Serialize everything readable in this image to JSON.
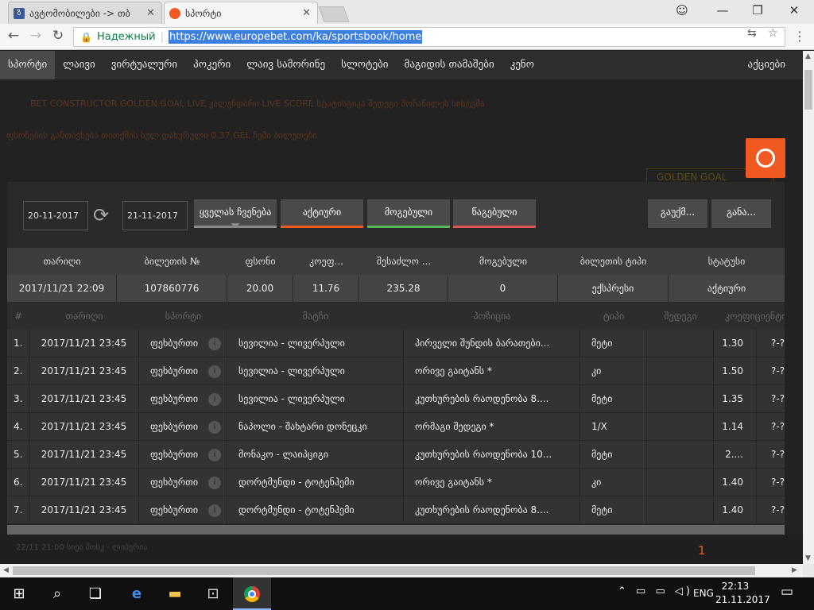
{
  "browser": {
    "tabs": [
      {
        "title": "ავტომობილები -> თბ",
        "favicon_color": "#3b5998"
      },
      {
        "title": "სპორტი",
        "favicon_color": "#f05a22"
      }
    ],
    "url": "https://www.europebet.com/ka/sportsbook/home",
    "secure_label": "Надежный"
  },
  "nav": {
    "items": [
      "სპორტი",
      "ლაივი",
      "ვირტუალური",
      "პოკერი",
      "ლაივ სამორინე",
      "სლოტები",
      "მაგიდის თამაშები",
      "კენო"
    ],
    "right": "აქციები"
  },
  "background": {
    "subnav": "BET CONSTRUCTOR   GOLDEN GOAL   LIVE კალენდარი   LIVE SCORE   სტატისტიკა   შედეგი   მონაწილეს სისტემა",
    "subnav2": "ფსონების განთავსება   თითქმის   სულ დახურული 0.37 GEL   ჩემი ბილეთები",
    "golden_goal": "GOLDEN GOAL",
    "bottom_left": "22/11 21:00         სიეა შოსკ - ლიბერია",
    "page_num": "1"
  },
  "filters": {
    "date_from": "20-11-2017",
    "date_to": "21-11-2017",
    "all": "ყველას ჩვენება",
    "active": "აქტიური",
    "won": "მოგებული",
    "lost": "წაგებული",
    "btn_a": "გაუქმ...",
    "btn_b": "განა..."
  },
  "ticket": {
    "headers": [
      "თარიღი",
      "ბილეთის №",
      "ფსონი",
      "კოეფ...",
      "შესაძლო ...",
      "მოგებული",
      "ბილეთის ტიპი",
      "სტატუსი"
    ],
    "row": [
      "2017/11/21 22:09",
      "107860776",
      "20.00",
      "11.76",
      "235.28",
      "0",
      "ექსპრესი",
      "აქტიური"
    ]
  },
  "selections": {
    "headers": [
      "#",
      "თარიღი",
      "სპორტი",
      "მატჩი",
      "პოზიცია",
      "ტიპი",
      "შედეგი",
      "კოეფიციენტი"
    ],
    "rows": [
      {
        "n": "1.",
        "date": "2017/11/21 23:45",
        "sport": "ფეხბურთი",
        "match": "სევილია - ლივერპული",
        "position": "პირველი შუნდის ბარათები...",
        "type": "მეტი",
        "result": "",
        "odds": "1.30",
        "extra": "?-?"
      },
      {
        "n": "2.",
        "date": "2017/11/21 23:45",
        "sport": "ფეხბურთი",
        "match": "სევილია - ლივერპული",
        "position": "ორივე გაიტანს *",
        "type": "კი",
        "result": "",
        "odds": "1.50",
        "extra": "?-?"
      },
      {
        "n": "3.",
        "date": "2017/11/21 23:45",
        "sport": "ფეხბურთი",
        "match": "სევილია - ლივერპული",
        "position": "კუთხურების რაოდენობა 8....",
        "type": "მეტი",
        "result": "",
        "odds": "1.35",
        "extra": "?-?"
      },
      {
        "n": "4.",
        "date": "2017/11/21 23:45",
        "sport": "ფეხბურთი",
        "match": "ნაპოლი - შახტარი დონეცკი",
        "position": "ორმაგი შედეგი *",
        "type": "1/X",
        "result": "",
        "odds": "1.14",
        "extra": "?-?"
      },
      {
        "n": "5.",
        "date": "2017/11/21 23:45",
        "sport": "ფეხბურთი",
        "match": "მონაკო - ლაიპციგი",
        "position": "კუთხურების რაოდენობა 10...",
        "type": "მეტი",
        "result": "",
        "odds": "2....",
        "extra": "?-?"
      },
      {
        "n": "6.",
        "date": "2017/11/21 23:45",
        "sport": "ფეხბურთი",
        "match": "დორტმუნდი - ტოტენჰემი",
        "position": "ორივე გაიტანს *",
        "type": "კი",
        "result": "",
        "odds": "1.40",
        "extra": "?-?"
      },
      {
        "n": "7.",
        "date": "2017/11/21 23:45",
        "sport": "ფეხბურთი",
        "match": "დორტმუნდი - ტოტენჰემი",
        "position": "კუთხურების რაოდენობა 8....",
        "type": "მეტი",
        "result": "",
        "odds": "1.40",
        "extra": "?-?"
      }
    ]
  },
  "taskbar": {
    "lang": "ENG",
    "time": "22:13",
    "date": "21.11.2017"
  }
}
